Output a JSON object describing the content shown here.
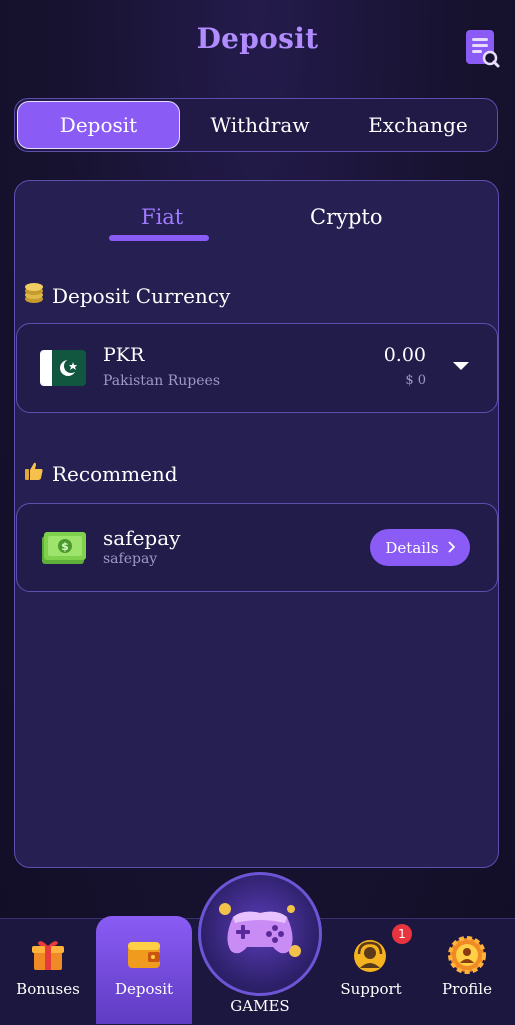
{
  "header": {
    "title": "Deposit",
    "history_icon": "order-search-icon"
  },
  "tabs": [
    {
      "label": "Deposit",
      "active": true
    },
    {
      "label": "Withdraw",
      "active": false
    },
    {
      "label": "Exchange",
      "active": false
    }
  ],
  "subtabs": [
    {
      "label": "Fiat",
      "active": true
    },
    {
      "label": "Crypto",
      "active": false
    }
  ],
  "currency_section": {
    "label": "Deposit Currency",
    "icon": "coins-icon",
    "code": "PKR",
    "name": "Pakistan Rupees",
    "amount": "0.00",
    "usd": "$ 0"
  },
  "recommend_section": {
    "label": "Recommend",
    "icon": "thumbs-up-icon",
    "method_name": "safepay",
    "method_sub": "safepay",
    "details_label": "Details"
  },
  "nav": {
    "items": [
      {
        "label": "Bonuses",
        "icon": "gift-icon"
      },
      {
        "label": "Deposit",
        "icon": "wallet-icon"
      },
      {
        "label": "GAMES",
        "icon": "gamepad-icon"
      },
      {
        "label": "Support",
        "icon": "support-agent-icon",
        "badge": "1"
      },
      {
        "label": "Profile",
        "icon": "profile-gear-icon"
      }
    ]
  },
  "colors": {
    "accent": "#8a5cf5",
    "title": "#b08cff",
    "background": "#17122f",
    "card": "#251f52"
  }
}
